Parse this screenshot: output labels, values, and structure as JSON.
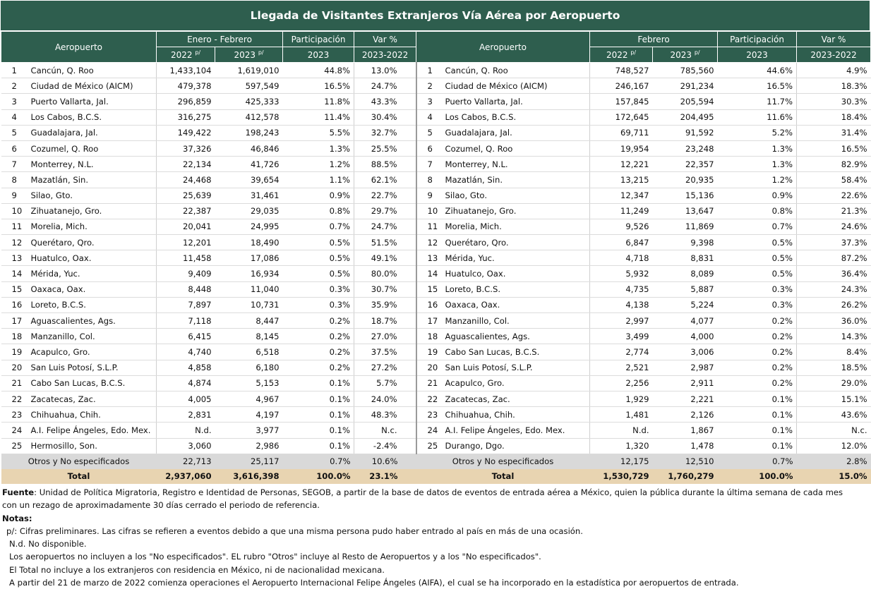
{
  "title": "Llegada de Visitantes Extranjeros Vía Aérea por Aeropuerto",
  "headers": {
    "aeropuerto": "Aeropuerto",
    "left_period": "Enero - Febrero",
    "right_period": "Febrero",
    "participacion": "Participación",
    "var": "Var %",
    "y2022": "2022",
    "y2023": "2023",
    "prelim": "p/",
    "part_year": "2023",
    "var_years": "2023-2022"
  },
  "left_rows": [
    {
      "rank": "1",
      "name": "Cancún, Q. Roo",
      "v2022": "1,433,104",
      "v2023": "1,619,010",
      "part": "44.8%",
      "var": "13.0%"
    },
    {
      "rank": "2",
      "name": "Ciudad de México (AICM)",
      "v2022": "479,378",
      "v2023": "597,549",
      "part": "16.5%",
      "var": "24.7%"
    },
    {
      "rank": "3",
      "name": "Puerto Vallarta, Jal.",
      "v2022": "296,859",
      "v2023": "425,333",
      "part": "11.8%",
      "var": "43.3%"
    },
    {
      "rank": "4",
      "name": "Los Cabos, B.C.S.",
      "v2022": "316,275",
      "v2023": "412,578",
      "part": "11.4%",
      "var": "30.4%"
    },
    {
      "rank": "5",
      "name": "Guadalajara, Jal.",
      "v2022": "149,422",
      "v2023": "198,243",
      "part": "5.5%",
      "var": "32.7%"
    },
    {
      "rank": "6",
      "name": "Cozumel, Q. Roo",
      "v2022": "37,326",
      "v2023": "46,846",
      "part": "1.3%",
      "var": "25.5%"
    },
    {
      "rank": "7",
      "name": "Monterrey, N.L.",
      "v2022": "22,134",
      "v2023": "41,726",
      "part": "1.2%",
      "var": "88.5%"
    },
    {
      "rank": "8",
      "name": "Mazatlán, Sin.",
      "v2022": "24,468",
      "v2023": "39,654",
      "part": "1.1%",
      "var": "62.1%"
    },
    {
      "rank": "9",
      "name": "Silao, Gto.",
      "v2022": "25,639",
      "v2023": "31,461",
      "part": "0.9%",
      "var": "22.7%"
    },
    {
      "rank": "10",
      "name": "Zihuatanejo, Gro.",
      "v2022": "22,387",
      "v2023": "29,035",
      "part": "0.8%",
      "var": "29.7%"
    },
    {
      "rank": "11",
      "name": "Morelia, Mich.",
      "v2022": "20,041",
      "v2023": "24,995",
      "part": "0.7%",
      "var": "24.7%"
    },
    {
      "rank": "12",
      "name": "Querétaro, Qro.",
      "v2022": "12,201",
      "v2023": "18,490",
      "part": "0.5%",
      "var": "51.5%"
    },
    {
      "rank": "13",
      "name": "Huatulco, Oax.",
      "v2022": "11,458",
      "v2023": "17,086",
      "part": "0.5%",
      "var": "49.1%"
    },
    {
      "rank": "14",
      "name": "Mérida, Yuc.",
      "v2022": "9,409",
      "v2023": "16,934",
      "part": "0.5%",
      "var": "80.0%"
    },
    {
      "rank": "15",
      "name": "Oaxaca, Oax.",
      "v2022": "8,448",
      "v2023": "11,040",
      "part": "0.3%",
      "var": "30.7%"
    },
    {
      "rank": "16",
      "name": "Loreto, B.C.S.",
      "v2022": "7,897",
      "v2023": "10,731",
      "part": "0.3%",
      "var": "35.9%"
    },
    {
      "rank": "17",
      "name": "Aguascalientes, Ags.",
      "v2022": "7,118",
      "v2023": "8,447",
      "part": "0.2%",
      "var": "18.7%"
    },
    {
      "rank": "18",
      "name": "Manzanillo, Col.",
      "v2022": "6,415",
      "v2023": "8,145",
      "part": "0.2%",
      "var": "27.0%"
    },
    {
      "rank": "19",
      "name": "Acapulco, Gro.",
      "v2022": "4,740",
      "v2023": "6,518",
      "part": "0.2%",
      "var": "37.5%"
    },
    {
      "rank": "20",
      "name": "San Luis Potosí, S.L.P.",
      "v2022": "4,858",
      "v2023": "6,180",
      "part": "0.2%",
      "var": "27.2%"
    },
    {
      "rank": "21",
      "name": "Cabo San Lucas, B.C.S.",
      "v2022": "4,874",
      "v2023": "5,153",
      "part": "0.1%",
      "var": "5.7%"
    },
    {
      "rank": "22",
      "name": "Zacatecas, Zac.",
      "v2022": "4,005",
      "v2023": "4,967",
      "part": "0.1%",
      "var": "24.0%"
    },
    {
      "rank": "23",
      "name": "Chihuahua, Chih.",
      "v2022": "2,831",
      "v2023": "4,197",
      "part": "0.1%",
      "var": "48.3%"
    },
    {
      "rank": "24",
      "name": "A.I. Felipe Ángeles, Edo. Mex.",
      "v2022": "N.d.",
      "v2023": "3,977",
      "part": "0.1%",
      "var": "N.c."
    },
    {
      "rank": "25",
      "name": "Hermosillo, Son.",
      "v2022": "3,060",
      "v2023": "2,986",
      "part": "0.1%",
      "var": "-2.4%"
    }
  ],
  "right_rows": [
    {
      "rank": "1",
      "name": "Cancún, Q. Roo",
      "v2022": "748,527",
      "v2023": "785,560",
      "part": "44.6%",
      "var": "4.9%"
    },
    {
      "rank": "2",
      "name": "Ciudad de México (AICM)",
      "v2022": "246,167",
      "v2023": "291,234",
      "part": "16.5%",
      "var": "18.3%"
    },
    {
      "rank": "3",
      "name": "Puerto Vallarta, Jal.",
      "v2022": "157,845",
      "v2023": "205,594",
      "part": "11.7%",
      "var": "30.3%"
    },
    {
      "rank": "4",
      "name": "Los Cabos, B.C.S.",
      "v2022": "172,645",
      "v2023": "204,495",
      "part": "11.6%",
      "var": "18.4%"
    },
    {
      "rank": "5",
      "name": "Guadalajara, Jal.",
      "v2022": "69,711",
      "v2023": "91,592",
      "part": "5.2%",
      "var": "31.4%"
    },
    {
      "rank": "6",
      "name": "Cozumel, Q. Roo",
      "v2022": "19,954",
      "v2023": "23,248",
      "part": "1.3%",
      "var": "16.5%"
    },
    {
      "rank": "7",
      "name": "Monterrey, N.L.",
      "v2022": "12,221",
      "v2023": "22,357",
      "part": "1.3%",
      "var": "82.9%"
    },
    {
      "rank": "8",
      "name": "Mazatlán, Sin.",
      "v2022": "13,215",
      "v2023": "20,935",
      "part": "1.2%",
      "var": "58.4%"
    },
    {
      "rank": "9",
      "name": "Silao, Gto.",
      "v2022": "12,347",
      "v2023": "15,136",
      "part": "0.9%",
      "var": "22.6%"
    },
    {
      "rank": "10",
      "name": "Zihuatanejo, Gro.",
      "v2022": "11,249",
      "v2023": "13,647",
      "part": "0.8%",
      "var": "21.3%"
    },
    {
      "rank": "11",
      "name": "Morelia, Mich.",
      "v2022": "9,526",
      "v2023": "11,869",
      "part": "0.7%",
      "var": "24.6%"
    },
    {
      "rank": "12",
      "name": "Querétaro, Qro.",
      "v2022": "6,847",
      "v2023": "9,398",
      "part": "0.5%",
      "var": "37.3%"
    },
    {
      "rank": "13",
      "name": "Mérida, Yuc.",
      "v2022": "4,718",
      "v2023": "8,831",
      "part": "0.5%",
      "var": "87.2%"
    },
    {
      "rank": "14",
      "name": "Huatulco, Oax.",
      "v2022": "5,932",
      "v2023": "8,089",
      "part": "0.5%",
      "var": "36.4%"
    },
    {
      "rank": "15",
      "name": "Loreto, B.C.S.",
      "v2022": "4,735",
      "v2023": "5,887",
      "part": "0.3%",
      "var": "24.3%"
    },
    {
      "rank": "16",
      "name": "Oaxaca, Oax.",
      "v2022": "4,138",
      "v2023": "5,224",
      "part": "0.3%",
      "var": "26.2%"
    },
    {
      "rank": "17",
      "name": "Manzanillo, Col.",
      "v2022": "2,997",
      "v2023": "4,077",
      "part": "0.2%",
      "var": "36.0%"
    },
    {
      "rank": "18",
      "name": "Aguascalientes, Ags.",
      "v2022": "3,499",
      "v2023": "4,000",
      "part": "0.2%",
      "var": "14.3%"
    },
    {
      "rank": "19",
      "name": "Cabo San Lucas, B.C.S.",
      "v2022": "2,774",
      "v2023": "3,006",
      "part": "0.2%",
      "var": "8.4%"
    },
    {
      "rank": "20",
      "name": "San Luis Potosí, S.L.P.",
      "v2022": "2,521",
      "v2023": "2,987",
      "part": "0.2%",
      "var": "18.5%"
    },
    {
      "rank": "21",
      "name": "Acapulco, Gro.",
      "v2022": "2,256",
      "v2023": "2,911",
      "part": "0.2%",
      "var": "29.0%"
    },
    {
      "rank": "22",
      "name": "Zacatecas, Zac.",
      "v2022": "1,929",
      "v2023": "2,221",
      "part": "0.1%",
      "var": "15.1%"
    },
    {
      "rank": "23",
      "name": "Chihuahua, Chih.",
      "v2022": "1,481",
      "v2023": "2,126",
      "part": "0.1%",
      "var": "43.6%"
    },
    {
      "rank": "24",
      "name": "A.I. Felipe Ángeles, Edo. Mex.",
      "v2022": "N.d.",
      "v2023": "1,867",
      "part": "0.1%",
      "var": "N.c."
    },
    {
      "rank": "25",
      "name": "Durango, Dgo.",
      "v2022": "1,320",
      "v2023": "1,478",
      "part": "0.1%",
      "var": "12.0%"
    }
  ],
  "left_otros": {
    "label": "Otros y No especificados",
    "v2022": "22,713",
    "v2023": "25,117",
    "part": "0.7%",
    "var": "10.6%"
  },
  "right_otros": {
    "label": "Otros y No especificados",
    "v2022": "12,175",
    "v2023": "12,510",
    "part": "0.7%",
    "var": "2.8%"
  },
  "left_total": {
    "label": "Total",
    "v2022": "2,937,060",
    "v2023": "3,616,398",
    "part": "100.0%",
    "var": "23.1%"
  },
  "right_total": {
    "label": "Total",
    "v2022": "1,530,729",
    "v2023": "1,760,279",
    "part": "100.0%",
    "var": "15.0%"
  },
  "notes": {
    "fuente_label": "Fuente",
    "fuente_text1": ": Unidad de Política Migratoria, Registro e Identidad de Personas, SEGOB, a partir de la base de datos de eventos de entrada aérea a México, quien la pública durante la última semana de cada mes",
    "fuente_text2": "con un rezago de aproximadamente 30 días cerrado el periodo de referencia.",
    "notas_label": "Notas:",
    "n1": "  p/: Cifras preliminares.   Las cifras se refieren a eventos debido a que una misma persona pudo haber entrado al país en más de una ocasión.",
    "n2": "N.d. No disponible.",
    "n3": "Los aeropuertos no incluyen a los \"No especificados\".   EL rubro \"Otros\" incluye al Resto de Aeropuertos y a los \"No especificados\".",
    "n4": "El Total no  incluye a los extranjeros con residencia en México, ni de nacionalidad mexicana.",
    "n5": "A partir del 21 de marzo de 2022 comienza operaciones el Aeropuerto Internacional Felipe Ángeles (AIFA), el cual se ha incorporado en la estadística por aeropuertos de entrada."
  },
  "colors": {
    "header_green": "#2e5e4e",
    "otros_gray": "#d9d9d9",
    "total_tan": "#e8d4b1"
  }
}
